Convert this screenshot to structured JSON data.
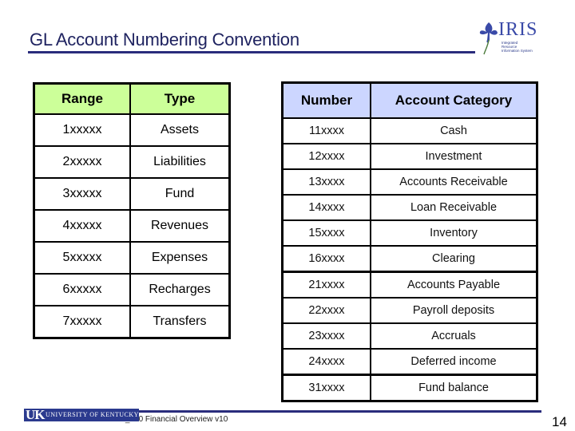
{
  "slide": {
    "title": "GL Account Numbering Convention",
    "page_number": "14",
    "footer_text": "FI_200 Financial Overview v10"
  },
  "logos": {
    "iris": {
      "word": "IRIS",
      "subtitle": "Integrated Resource Information System",
      "icon": "iris-flower-icon"
    },
    "uk": {
      "mark": "UK",
      "name": "UNIVERSITY OF KENTUCKY"
    }
  },
  "colors": {
    "title": "#1f2360",
    "rule": "#2a2c7c",
    "range_header_bg": "#ccff99",
    "number_header_bg": "#ccd6ff"
  },
  "range_table": {
    "headers": [
      "Range",
      "Type"
    ],
    "rows": [
      [
        "1xxxxx",
        "Assets"
      ],
      [
        "2xxxxx",
        "Liabilities"
      ],
      [
        "3xxxxx",
        "Fund"
      ],
      [
        "4xxxxx",
        "Revenues"
      ],
      [
        "5xxxxx",
        "Expenses"
      ],
      [
        "6xxxxx",
        "Recharges"
      ],
      [
        "7xxxxx",
        "Transfers"
      ]
    ]
  },
  "number_table": {
    "headers": [
      "Number",
      "Account Category"
    ],
    "rows": [
      [
        "11xxxx",
        "Cash"
      ],
      [
        "12xxxx",
        "Investment"
      ],
      [
        "13xxxx",
        "Accounts Receivable"
      ],
      [
        "14xxxx",
        "Loan Receivable"
      ],
      [
        "15xxxx",
        "Inventory"
      ],
      [
        "16xxxx",
        "Clearing"
      ],
      [
        "21xxxx",
        "Accounts Payable"
      ],
      [
        "22xxxx",
        "Payroll deposits"
      ],
      [
        "23xxxx",
        "Accruals"
      ],
      [
        "24xxxx",
        "Deferred income"
      ],
      [
        "31xxxx",
        "Fund balance"
      ]
    ]
  }
}
